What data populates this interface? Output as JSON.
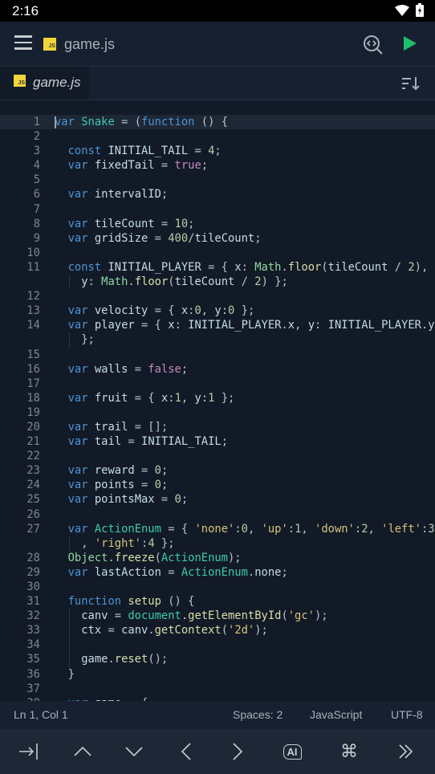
{
  "status": {
    "time": "2:16"
  },
  "appbar": {
    "title": "game.js",
    "file_icon": "JS"
  },
  "tab": {
    "label": "game.js",
    "file_icon": "JS"
  },
  "editor": {
    "rows": [
      {
        "ln": "1",
        "cur": true,
        "t": [
          [
            "var",
            "k"
          ],
          [
            " ",
            "p"
          ],
          [
            "Snake",
            "t"
          ],
          [
            " = (",
            "p"
          ],
          [
            "function",
            "k"
          ],
          [
            " () {",
            "p"
          ]
        ]
      },
      {
        "ln": "2",
        "t": []
      },
      {
        "ln": "3",
        "t": [
          [
            "  const",
            "k"
          ],
          [
            " INITIAL_TAIL",
            "v"
          ],
          [
            " = ",
            "p"
          ],
          [
            "4",
            "n"
          ],
          [
            ";",
            "p"
          ]
        ]
      },
      {
        "ln": "4",
        "t": [
          [
            "  var",
            "k"
          ],
          [
            " fixedTail",
            "v"
          ],
          [
            " = ",
            "p"
          ],
          [
            "true",
            "b"
          ],
          [
            ";",
            "p"
          ]
        ]
      },
      {
        "ln": "5",
        "t": []
      },
      {
        "ln": "6",
        "t": [
          [
            "  var",
            "k"
          ],
          [
            " intervalID",
            "v"
          ],
          [
            ";",
            "p"
          ]
        ]
      },
      {
        "ln": "7",
        "t": []
      },
      {
        "ln": "8",
        "t": [
          [
            "  var",
            "k"
          ],
          [
            " tileCount",
            "v"
          ],
          [
            " = ",
            "p"
          ],
          [
            "10",
            "n"
          ],
          [
            ";",
            "p"
          ]
        ]
      },
      {
        "ln": "9",
        "t": [
          [
            "  var",
            "k"
          ],
          [
            " gridSize",
            "v"
          ],
          [
            " = ",
            "p"
          ],
          [
            "400",
            "n"
          ],
          [
            "/",
            "p"
          ],
          [
            "tileCount",
            "v"
          ],
          [
            ";",
            "p"
          ]
        ]
      },
      {
        "ln": "10",
        "t": []
      },
      {
        "ln": "11",
        "t": [
          [
            "  const",
            "k"
          ],
          [
            " INITIAL_PLAYER",
            "v"
          ],
          [
            " = { ",
            "p"
          ],
          [
            "x",
            "v"
          ],
          [
            ": ",
            "p"
          ],
          [
            "Math",
            "c"
          ],
          [
            ".",
            "p"
          ],
          [
            "floor",
            "f"
          ],
          [
            "(",
            "p"
          ],
          [
            "tileCount",
            "v"
          ],
          [
            " / ",
            "p"
          ],
          [
            "2",
            "n"
          ],
          [
            "),",
            "p"
          ]
        ]
      },
      {
        "ln": "",
        "g": true,
        "t": [
          [
            "    y",
            "v"
          ],
          [
            ": ",
            "p"
          ],
          [
            "Math",
            "c"
          ],
          [
            ".",
            "p"
          ],
          [
            "floor",
            "f"
          ],
          [
            "(",
            "p"
          ],
          [
            "tileCount",
            "v"
          ],
          [
            " / ",
            "p"
          ],
          [
            "2",
            "n"
          ],
          [
            ") };",
            "p"
          ]
        ]
      },
      {
        "ln": "12",
        "t": []
      },
      {
        "ln": "13",
        "t": [
          [
            "  var",
            "k"
          ],
          [
            " velocity",
            "v"
          ],
          [
            " = { ",
            "p"
          ],
          [
            "x",
            "v"
          ],
          [
            ":",
            "p"
          ],
          [
            "0",
            "n"
          ],
          [
            ", ",
            "p"
          ],
          [
            "y",
            "v"
          ],
          [
            ":",
            "p"
          ],
          [
            "0",
            "n"
          ],
          [
            " };",
            "p"
          ]
        ]
      },
      {
        "ln": "14",
        "t": [
          [
            "  var",
            "k"
          ],
          [
            " player",
            "v"
          ],
          [
            " = { ",
            "p"
          ],
          [
            "x",
            "v"
          ],
          [
            ": ",
            "p"
          ],
          [
            "INITIAL_PLAYER",
            "v"
          ],
          [
            ".",
            "p"
          ],
          [
            "x",
            "v"
          ],
          [
            ", ",
            "p"
          ],
          [
            "y",
            "v"
          ],
          [
            ": ",
            "p"
          ],
          [
            "INITIAL_PLAYER",
            "v"
          ],
          [
            ".",
            "p"
          ],
          [
            "y",
            "v"
          ]
        ]
      },
      {
        "ln": "",
        "g": true,
        "t": [
          [
            "    };",
            "p"
          ]
        ]
      },
      {
        "ln": "15",
        "t": []
      },
      {
        "ln": "16",
        "t": [
          [
            "  var",
            "k"
          ],
          [
            " walls",
            "v"
          ],
          [
            " = ",
            "p"
          ],
          [
            "false",
            "b"
          ],
          [
            ";",
            "p"
          ]
        ]
      },
      {
        "ln": "17",
        "t": []
      },
      {
        "ln": "18",
        "t": [
          [
            "  var",
            "k"
          ],
          [
            " fruit",
            "v"
          ],
          [
            " = { ",
            "p"
          ],
          [
            "x",
            "v"
          ],
          [
            ":",
            "p"
          ],
          [
            "1",
            "n"
          ],
          [
            ", ",
            "p"
          ],
          [
            "y",
            "v"
          ],
          [
            ":",
            "p"
          ],
          [
            "1",
            "n"
          ],
          [
            " };",
            "p"
          ]
        ]
      },
      {
        "ln": "19",
        "t": []
      },
      {
        "ln": "20",
        "t": [
          [
            "  var",
            "k"
          ],
          [
            " trail",
            "v"
          ],
          [
            " = [];",
            "p"
          ]
        ]
      },
      {
        "ln": "21",
        "t": [
          [
            "  var",
            "k"
          ],
          [
            " tail",
            "v"
          ],
          [
            " = ",
            "p"
          ],
          [
            "INITIAL_TAIL",
            "v"
          ],
          [
            ";",
            "p"
          ]
        ]
      },
      {
        "ln": "22",
        "t": []
      },
      {
        "ln": "23",
        "t": [
          [
            "  var",
            "k"
          ],
          [
            " reward",
            "v"
          ],
          [
            " = ",
            "p"
          ],
          [
            "0",
            "n"
          ],
          [
            ";",
            "p"
          ]
        ]
      },
      {
        "ln": "24",
        "t": [
          [
            "  var",
            "k"
          ],
          [
            " points",
            "v"
          ],
          [
            " = ",
            "p"
          ],
          [
            "0",
            "n"
          ],
          [
            ";",
            "p"
          ]
        ]
      },
      {
        "ln": "25",
        "t": [
          [
            "  var",
            "k"
          ],
          [
            " pointsMax",
            "v"
          ],
          [
            " = ",
            "p"
          ],
          [
            "0",
            "n"
          ],
          [
            ";",
            "p"
          ]
        ]
      },
      {
        "ln": "26",
        "t": []
      },
      {
        "ln": "27",
        "t": [
          [
            "  var",
            "k"
          ],
          [
            " ActionEnum",
            "t"
          ],
          [
            " = { ",
            "p"
          ],
          [
            "'none'",
            "s"
          ],
          [
            ":",
            "p"
          ],
          [
            "0",
            "n"
          ],
          [
            ", ",
            "p"
          ],
          [
            "'up'",
            "s"
          ],
          [
            ":",
            "p"
          ],
          [
            "1",
            "n"
          ],
          [
            ", ",
            "p"
          ],
          [
            "'down'",
            "s"
          ],
          [
            ":",
            "p"
          ],
          [
            "2",
            "n"
          ],
          [
            ", ",
            "p"
          ],
          [
            "'left'",
            "s"
          ],
          [
            ":",
            "p"
          ],
          [
            "3",
            "n"
          ]
        ]
      },
      {
        "ln": "",
        "g": true,
        "t": [
          [
            "    , ",
            "p"
          ],
          [
            "'right'",
            "s"
          ],
          [
            ":",
            "p"
          ],
          [
            "4",
            "n"
          ],
          [
            " };",
            "p"
          ]
        ]
      },
      {
        "ln": "28",
        "t": [
          [
            "  Object",
            "c"
          ],
          [
            ".",
            "p"
          ],
          [
            "freeze",
            "f"
          ],
          [
            "(",
            "p"
          ],
          [
            "ActionEnum",
            "t"
          ],
          [
            ");",
            "p"
          ]
        ]
      },
      {
        "ln": "29",
        "t": [
          [
            "  var",
            "k"
          ],
          [
            " lastAction",
            "v"
          ],
          [
            " = ",
            "p"
          ],
          [
            "ActionEnum",
            "t"
          ],
          [
            ".",
            "p"
          ],
          [
            "none",
            "v"
          ],
          [
            ";",
            "p"
          ]
        ]
      },
      {
        "ln": "30",
        "t": []
      },
      {
        "ln": "31",
        "t": [
          [
            "  function",
            "k"
          ],
          [
            " setup",
            "f"
          ],
          [
            " () {",
            "p"
          ]
        ]
      },
      {
        "ln": "32",
        "g": true,
        "t": [
          [
            "    canv",
            "v"
          ],
          [
            " = ",
            "p"
          ],
          [
            "document",
            "t"
          ],
          [
            ".",
            "p"
          ],
          [
            "getElementById",
            "f"
          ],
          [
            "(",
            "p"
          ],
          [
            "'gc'",
            "s"
          ],
          [
            ");",
            "p"
          ]
        ]
      },
      {
        "ln": "33",
        "g": true,
        "t": [
          [
            "    ctx",
            "v"
          ],
          [
            " = ",
            "p"
          ],
          [
            "canv",
            "v"
          ],
          [
            ".",
            "p"
          ],
          [
            "getContext",
            "f"
          ],
          [
            "(",
            "p"
          ],
          [
            "'2d'",
            "s"
          ],
          [
            ");",
            "p"
          ]
        ]
      },
      {
        "ln": "34",
        "g": true,
        "t": []
      },
      {
        "ln": "35",
        "g": true,
        "t": [
          [
            "    game",
            "v"
          ],
          [
            ".",
            "p"
          ],
          [
            "reset",
            "f"
          ],
          [
            "();",
            "p"
          ]
        ]
      },
      {
        "ln": "36",
        "t": [
          [
            "  }",
            "p"
          ]
        ]
      },
      {
        "ln": "37",
        "t": []
      },
      {
        "ln": "38",
        "t": [
          [
            "  var",
            "k"
          ],
          [
            " game",
            "v"
          ],
          [
            " = {",
            "p"
          ]
        ]
      }
    ]
  },
  "info": {
    "position": "Ln 1, Col 1",
    "indent": "Spaces: 2",
    "language": "JavaScript",
    "encoding": "UTF-8"
  },
  "toolbar": {
    "ai_label": "AI"
  },
  "colors": {
    "background": "#111a26",
    "bar": "#162030",
    "run": "#1fbf6a",
    "js_badge": "#f0d63a"
  }
}
